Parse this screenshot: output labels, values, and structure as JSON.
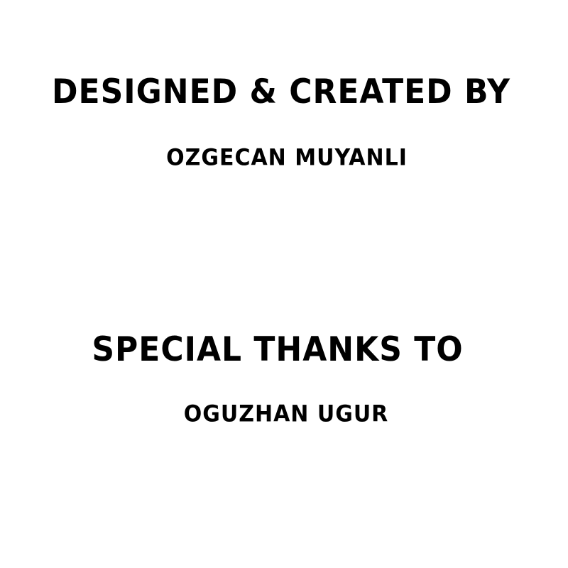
{
  "credits": {
    "designed_heading": "Designed & Created By",
    "designer_name": "Ozgecan Muyanli",
    "thanks_heading": "Special Thanks To",
    "thanked_name": "Oguzhan Ugur"
  },
  "colors": {
    "background": "#ffffff",
    "text": "#000000"
  }
}
